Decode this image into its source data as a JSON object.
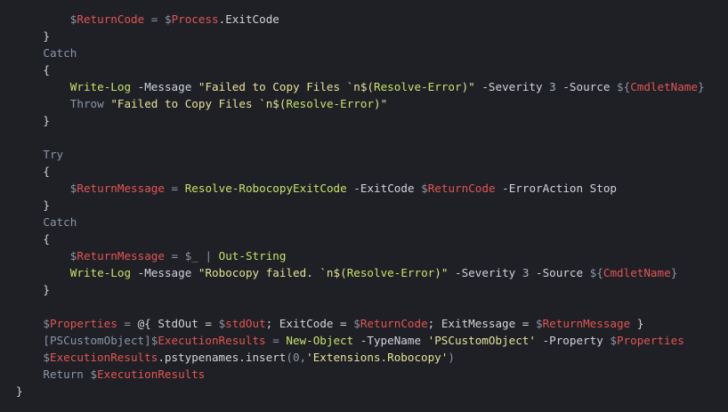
{
  "editor": {
    "background": "#1e2025",
    "colors": {
      "variable": "#e35454",
      "keyword": "#8a95a8",
      "command": "#c8e06a",
      "string": "#e6e197",
      "plain": "#d4d4d4"
    },
    "lines": [
      {
        "indent": 8,
        "tokens": [
          {
            "t": "$",
            "c": "op"
          },
          {
            "t": "ReturnCode",
            "c": "var"
          },
          {
            "t": " = ",
            "c": "op"
          },
          {
            "t": "$",
            "c": "op"
          },
          {
            "t": "Process",
            "c": "var"
          },
          {
            "t": ".ExitCode",
            "c": "plain"
          }
        ]
      },
      {
        "indent": 4,
        "tokens": [
          {
            "t": "}",
            "c": "plain"
          }
        ]
      },
      {
        "indent": 4,
        "tokens": [
          {
            "t": "Catch",
            "c": "kw"
          }
        ]
      },
      {
        "indent": 4,
        "tokens": [
          {
            "t": "{",
            "c": "plain"
          }
        ]
      },
      {
        "indent": 8,
        "tokens": [
          {
            "t": "Write-Log",
            "c": "cmd"
          },
          {
            "t": " -Message ",
            "c": "param"
          },
          {
            "t": "\"Failed to Copy Files `n$(",
            "c": "str"
          },
          {
            "t": "Resolve-Error",
            "c": "cmd"
          },
          {
            "t": ")\"",
            "c": "str"
          },
          {
            "t": " -Severity ",
            "c": "param"
          },
          {
            "t": "3",
            "c": "num"
          },
          {
            "t": " -Source ",
            "c": "param"
          },
          {
            "t": "${",
            "c": "op"
          },
          {
            "t": "CmdletName",
            "c": "var"
          },
          {
            "t": "}",
            "c": "op"
          }
        ]
      },
      {
        "indent": 8,
        "tokens": [
          {
            "t": "Throw",
            "c": "kw"
          },
          {
            "t": " ",
            "c": "plain"
          },
          {
            "t": "\"Failed to Copy Files `n$(",
            "c": "str"
          },
          {
            "t": "Resolve-Error",
            "c": "cmd"
          },
          {
            "t": ")\"",
            "c": "str"
          }
        ]
      },
      {
        "indent": 4,
        "tokens": [
          {
            "t": "}",
            "c": "plain"
          }
        ]
      },
      {
        "indent": 0,
        "tokens": []
      },
      {
        "indent": 4,
        "tokens": [
          {
            "t": "Try",
            "c": "kw"
          }
        ]
      },
      {
        "indent": 4,
        "tokens": [
          {
            "t": "{",
            "c": "plain"
          }
        ]
      },
      {
        "indent": 8,
        "tokens": [
          {
            "t": "$",
            "c": "op"
          },
          {
            "t": "ReturnMessage",
            "c": "var"
          },
          {
            "t": " = ",
            "c": "op"
          },
          {
            "t": "Resolve-RobocopyExitCode",
            "c": "cmd"
          },
          {
            "t": " -ExitCode ",
            "c": "param"
          },
          {
            "t": "$",
            "c": "op"
          },
          {
            "t": "ReturnCode",
            "c": "var"
          },
          {
            "t": " -ErrorAction Stop",
            "c": "param"
          }
        ]
      },
      {
        "indent": 4,
        "tokens": [
          {
            "t": "}",
            "c": "plain"
          }
        ]
      },
      {
        "indent": 4,
        "tokens": [
          {
            "t": "Catch",
            "c": "kw"
          }
        ]
      },
      {
        "indent": 4,
        "tokens": [
          {
            "t": "{",
            "c": "plain"
          }
        ]
      },
      {
        "indent": 8,
        "tokens": [
          {
            "t": "$",
            "c": "op"
          },
          {
            "t": "ReturnMessage",
            "c": "var"
          },
          {
            "t": " = ",
            "c": "op"
          },
          {
            "t": "$_",
            "c": "op"
          },
          {
            "t": " | ",
            "c": "op"
          },
          {
            "t": "Out-String",
            "c": "cmd"
          }
        ]
      },
      {
        "indent": 8,
        "tokens": [
          {
            "t": "Write-Log",
            "c": "cmd"
          },
          {
            "t": " -Message ",
            "c": "param"
          },
          {
            "t": "\"Robocopy failed. `n$(",
            "c": "str"
          },
          {
            "t": "Resolve-Error",
            "c": "cmd"
          },
          {
            "t": ")\"",
            "c": "str"
          },
          {
            "t": " -Severity ",
            "c": "param"
          },
          {
            "t": "3",
            "c": "num"
          },
          {
            "t": " -Source ",
            "c": "param"
          },
          {
            "t": "${",
            "c": "op"
          },
          {
            "t": "CmdletName",
            "c": "var"
          },
          {
            "t": "}",
            "c": "op"
          }
        ]
      },
      {
        "indent": 4,
        "tokens": [
          {
            "t": "}",
            "c": "plain"
          }
        ]
      },
      {
        "indent": 0,
        "tokens": []
      },
      {
        "indent": 4,
        "tokens": [
          {
            "t": "$",
            "c": "op"
          },
          {
            "t": "Properties",
            "c": "var"
          },
          {
            "t": " = ",
            "c": "op"
          },
          {
            "t": "@{",
            "c": "plain"
          },
          {
            "t": " StdOut = ",
            "c": "plain"
          },
          {
            "t": "$",
            "c": "op"
          },
          {
            "t": "stdOut",
            "c": "var"
          },
          {
            "t": "; ExitCode = ",
            "c": "plain"
          },
          {
            "t": "$",
            "c": "op"
          },
          {
            "t": "ReturnCode",
            "c": "var"
          },
          {
            "t": "; ExitMessage = ",
            "c": "plain"
          },
          {
            "t": "$",
            "c": "op"
          },
          {
            "t": "ReturnMessage",
            "c": "var"
          },
          {
            "t": " }",
            "c": "plain"
          }
        ]
      },
      {
        "indent": 4,
        "tokens": [
          {
            "t": "[PSCustomObject]",
            "c": "type"
          },
          {
            "t": "$",
            "c": "op"
          },
          {
            "t": "ExecutionResults",
            "c": "var"
          },
          {
            "t": " = ",
            "c": "op"
          },
          {
            "t": "New-Object",
            "c": "cmd"
          },
          {
            "t": " -TypeName ",
            "c": "param"
          },
          {
            "t": "'PSCustomObject'",
            "c": "str"
          },
          {
            "t": " -Property ",
            "c": "param"
          },
          {
            "t": "$",
            "c": "op"
          },
          {
            "t": "Properties",
            "c": "var"
          }
        ]
      },
      {
        "indent": 4,
        "tokens": [
          {
            "t": "$",
            "c": "op"
          },
          {
            "t": "ExecutionResults",
            "c": "var"
          },
          {
            "t": ".pstypenames.insert",
            "c": "plain"
          },
          {
            "t": "(0,",
            "c": "op"
          },
          {
            "t": "'Extensions.Robocopy'",
            "c": "str"
          },
          {
            "t": ")",
            "c": "op"
          }
        ]
      },
      {
        "indent": 4,
        "tokens": [
          {
            "t": "Return",
            "c": "kw"
          },
          {
            "t": " ",
            "c": "plain"
          },
          {
            "t": "$",
            "c": "op"
          },
          {
            "t": "ExecutionResults",
            "c": "var"
          }
        ]
      },
      {
        "indent": 0,
        "tokens": [
          {
            "t": "}",
            "c": "plain"
          }
        ]
      }
    ]
  }
}
